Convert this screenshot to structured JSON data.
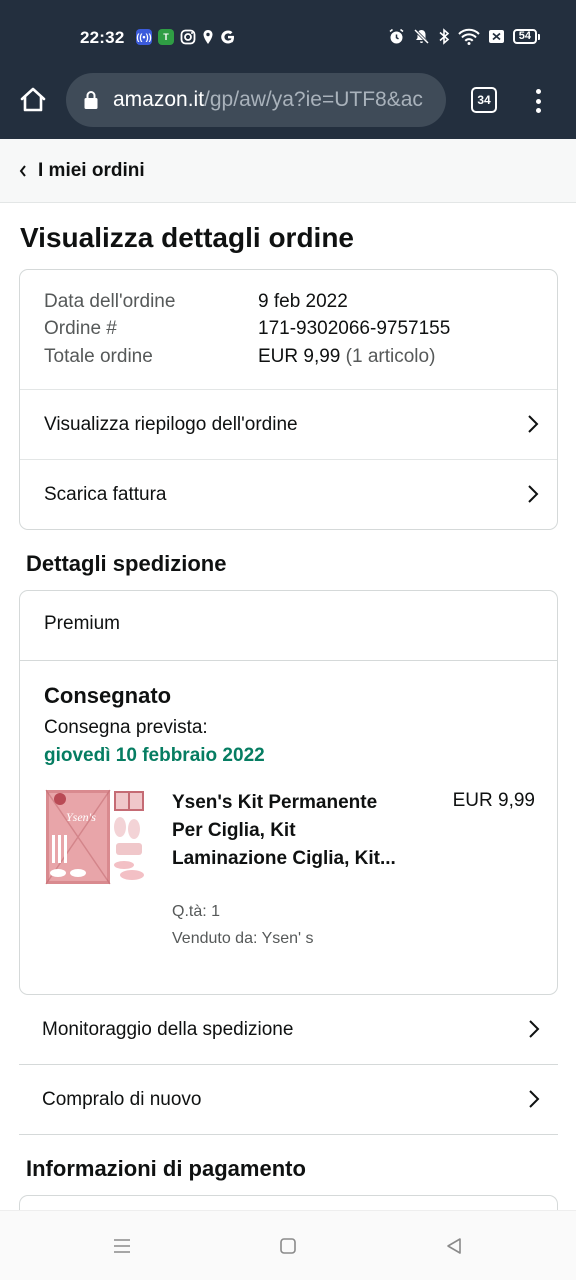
{
  "status_bar": {
    "time": "22:32",
    "left_icons": [
      "radio-icon",
      "teams-icon",
      "instagram-icon",
      "location-icon",
      "google-icon"
    ],
    "right_icons": [
      "alarm-icon",
      "mute-icon",
      "bluetooth-icon",
      "wifi-icon",
      "data-icon"
    ],
    "battery": "54"
  },
  "browser": {
    "url_host": "amazon.it",
    "url_path": "/gp/aw/ya?ie=UTF8&ac",
    "tab_count": "34"
  },
  "breadcrumb": {
    "label": "I miei ordini"
  },
  "page_title": "Visualizza dettagli ordine",
  "order_summary": {
    "date_label": "Data dell'ordine",
    "date_value": "9 feb 2022",
    "number_label": "Ordine #",
    "number_value": "171-9302066-9757155",
    "total_label": "Totale ordine",
    "total_value": "EUR 9,99",
    "total_items": "(1 articolo)",
    "links": [
      "Visualizza riepilogo dell'ordine",
      "Scarica fattura"
    ]
  },
  "shipping": {
    "section_title": "Dettagli spedizione",
    "shipping_type": "Premium",
    "status": "Consegnato",
    "delivery_label": "Consegna prevista:",
    "delivery_date": "giovedì 10 febbraio 2022",
    "delivery_date_color": "#067d62",
    "product": {
      "name": "Ysen's Kit Permanente Per Ciglia, Kit Laminazione Ciglia, Kit...",
      "price": "EUR 9,99",
      "qty": "Q.tà: 1",
      "seller": "Venduto da: Ysen' s",
      "image_brand": "Ysen's"
    }
  },
  "actions": [
    "Monitoraggio della spedizione",
    "Compralo di nuovo"
  ],
  "payment": {
    "section_title": "Informazioni di pagamento"
  },
  "nav": {
    "icons": [
      "menu-icon",
      "home-square-icon",
      "back-triangle-icon"
    ]
  }
}
